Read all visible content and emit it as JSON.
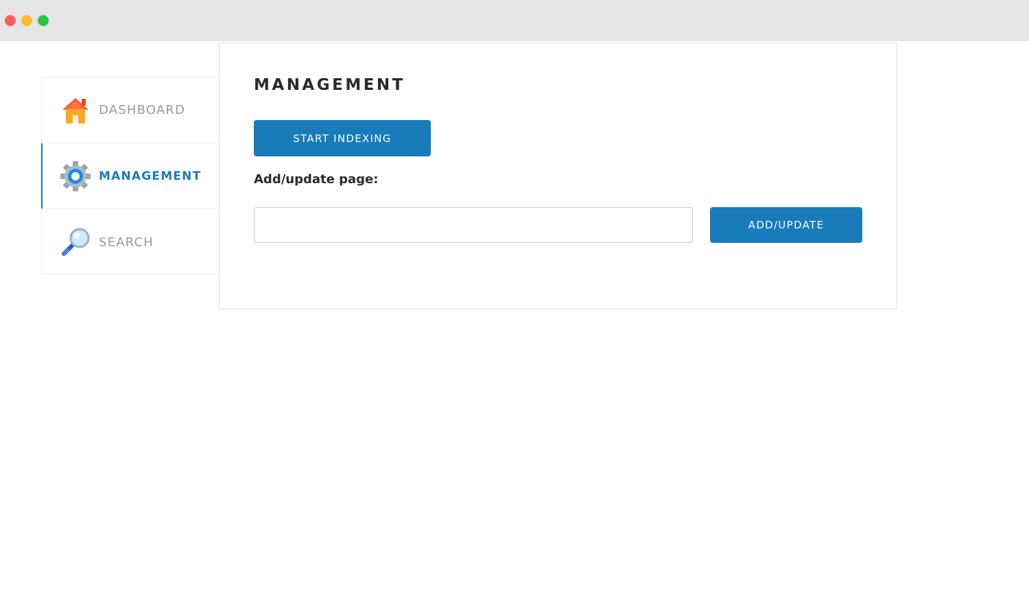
{
  "window": {
    "controls": [
      "close",
      "minimize",
      "maximize"
    ]
  },
  "sidebar": {
    "items": [
      {
        "label": "DASHBOARD",
        "icon": "house-icon",
        "active": false
      },
      {
        "label": "MANAGEMENT",
        "icon": "gear-icon",
        "active": true
      },
      {
        "label": "SEARCH",
        "icon": "magnifier-icon",
        "active": false
      }
    ]
  },
  "main": {
    "title": "MANAGEMENT",
    "start_indexing_label": "START INDEXING",
    "add_update_field_label": "Add/update page:",
    "add_update_input_value": "",
    "add_update_button_label": "ADD/UPDATE"
  },
  "colors": {
    "accent": "#187bba",
    "inactive_text": "#9a9a9a",
    "heading_text": "#2a2a2a"
  }
}
